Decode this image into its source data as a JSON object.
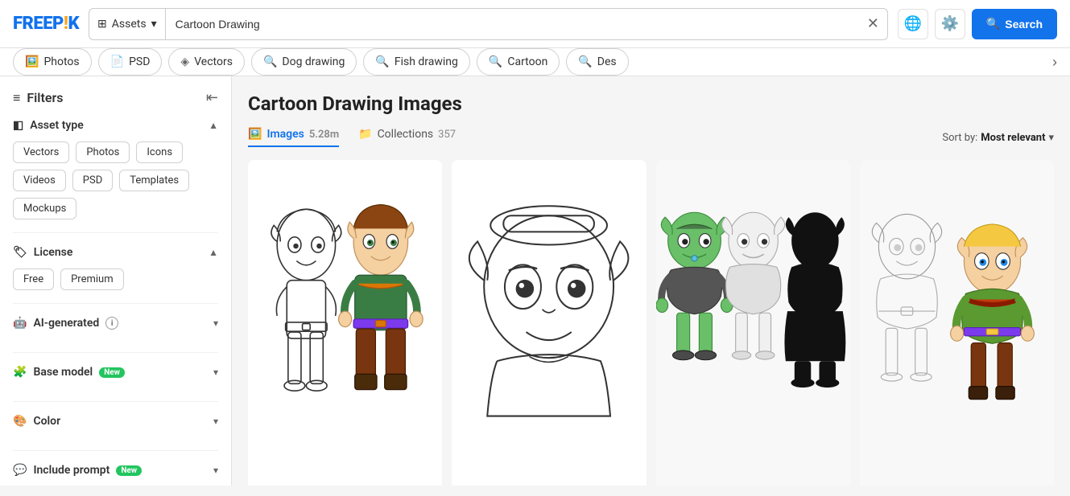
{
  "header": {
    "logo_text": "FREEP!K",
    "search_placeholder": "Cartoon Drawing",
    "assets_label": "Assets",
    "search_button_label": "Search",
    "language_icon": "🌐",
    "settings_icon": "⚙️"
  },
  "nav_pills": [
    {
      "id": "photos",
      "label": "Photos",
      "icon": "🖼️"
    },
    {
      "id": "psd",
      "label": "PSD",
      "icon": "📄"
    },
    {
      "id": "vectors",
      "label": "Vectors",
      "icon": "◈"
    },
    {
      "id": "dog-drawing",
      "label": "Dog drawing",
      "icon": "🔍"
    },
    {
      "id": "fish-drawing",
      "label": "Fish drawing",
      "icon": "🔍"
    },
    {
      "id": "cartoon",
      "label": "Cartoon",
      "icon": "🔍"
    },
    {
      "id": "des",
      "label": "Des",
      "icon": "🔍"
    }
  ],
  "sidebar": {
    "title": "Filters",
    "sections": [
      {
        "id": "asset-type",
        "title": "Asset type",
        "icon": "◧",
        "chips": [
          "Vectors",
          "Photos",
          "Icons",
          "Videos",
          "PSD",
          "Templates",
          "Mockups"
        ]
      },
      {
        "id": "license",
        "title": "License",
        "icon": "🏷",
        "chips": [
          "Free",
          "Premium"
        ]
      },
      {
        "id": "ai-generated",
        "title": "AI-generated",
        "icon": "🤖",
        "has_info": true
      },
      {
        "id": "base-model",
        "title": "Base model",
        "icon": "🧩",
        "badge": "New"
      },
      {
        "id": "color",
        "title": "Color",
        "icon": "🎨"
      },
      {
        "id": "include-prompt",
        "title": "Include prompt",
        "icon": "💬",
        "badge": "New"
      }
    ]
  },
  "content": {
    "title": "Cartoon Drawing Images",
    "tabs": [
      {
        "id": "images",
        "label": "Images",
        "count": "5.28m",
        "active": true
      },
      {
        "id": "collections",
        "label": "Collections",
        "count": "357",
        "active": false
      }
    ],
    "sort_label": "Sort by:",
    "sort_value": "Most relevant"
  }
}
